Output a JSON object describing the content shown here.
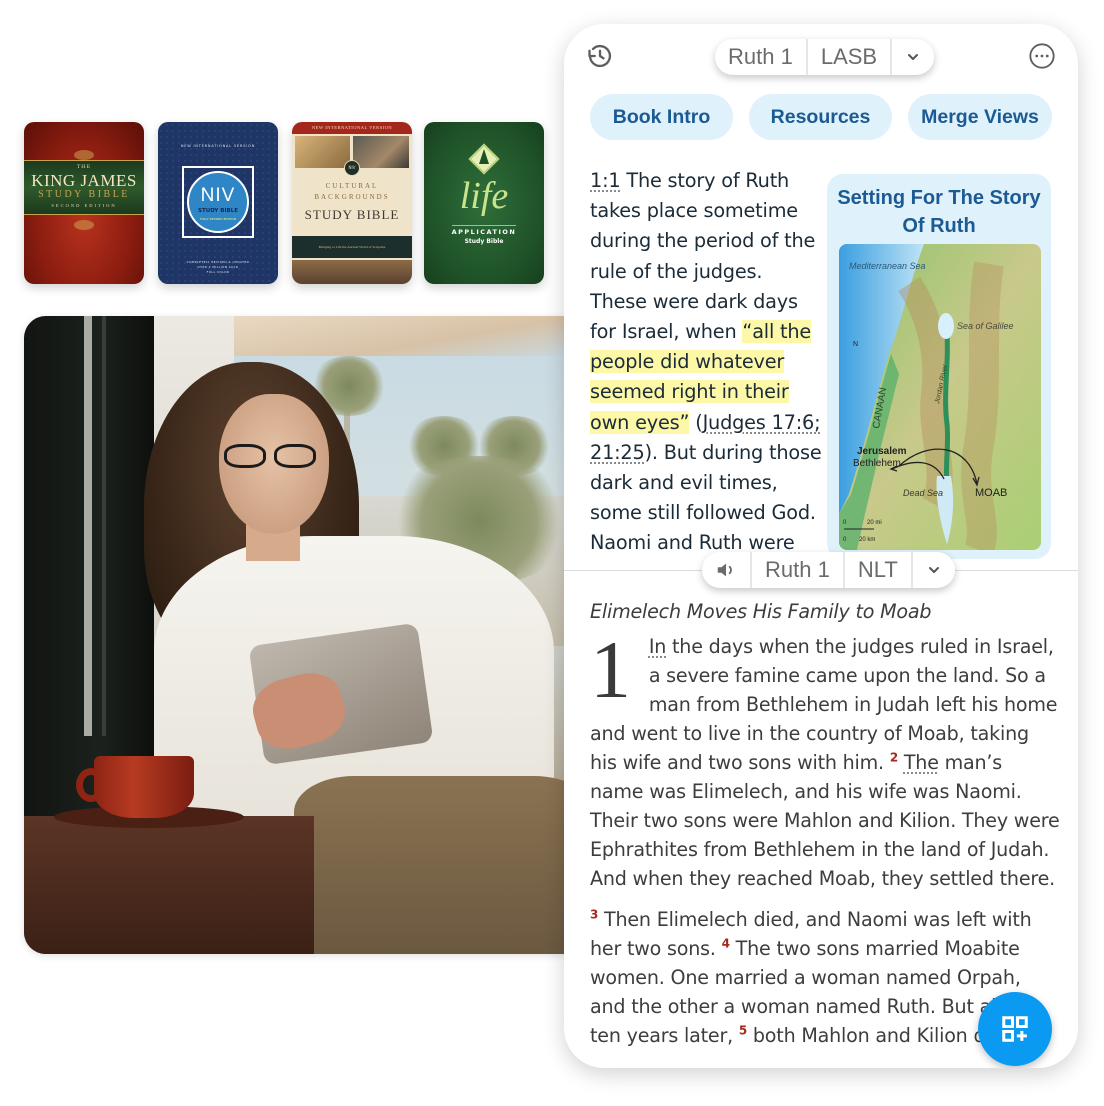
{
  "books": [
    {
      "id": "kjv",
      "line_small": "THE",
      "line1": "KING JAMES",
      "line2": "STUDY BIBLE",
      "line3": "SECOND EDITION"
    },
    {
      "id": "niv",
      "top": "NEW INTERNATIONAL VERSION",
      "title": "NIV",
      "subtitle": "STUDY BIBLE",
      "edition": "FULLY REVISED EDITION",
      "bottom": [
        "COMPLETELY REVISED & UPDATED",
        "OVER 2 MILLION SOLD",
        "FULL COLOR"
      ]
    },
    {
      "id": "cultural",
      "top": "NEW INTERNATIONAL VERSION",
      "badge": "NIV",
      "line1": "CULTURAL",
      "line2": "BACKGROUNDS",
      "line3": "STUDY BIBLE",
      "tagline": "Bringing to Life the Ancient World of Scripture"
    },
    {
      "id": "life",
      "title": "life",
      "line1": "APPLICATION",
      "line2": "Study Bible"
    }
  ],
  "photo": {
    "description": "woman-reading-tablet"
  },
  "reader": {
    "top_bar": {
      "history_icon": "history-icon",
      "more_icon": "more-horizontal-icon",
      "selector": {
        "book_chapter": "Ruth 1",
        "version": "LASB",
        "dropdown_icon": "chevron-down-icon"
      }
    },
    "tabs": [
      {
        "label": "Book Intro"
      },
      {
        "label": "Resources"
      },
      {
        "label": "Merge Views"
      }
    ],
    "commentary": {
      "ref": "1:1",
      "text_before": " The story of Ruth takes place sometime during the period of the rule of the judges. These were dark days for Israel, when ",
      "highlight": "“all the people did whatever seemed right in their own eyes”",
      "paren_open": " (",
      "cross_ref": "Judges 17:6; 21:25",
      "text_after": "). But during those dark and evil times, some still followed God. Naomi and Ruth were shining examples of strong character and staunch loyalty."
    },
    "map_card": {
      "title": "Setting For The Story Of Ruth",
      "labels": {
        "sea": "Mediterranean Sea",
        "galilee": "Sea of Galilee",
        "jordan": "Jordan River",
        "canaan": "CANAAN",
        "jerusalem": "Jerusalem",
        "bethlehem": "Bethlehem",
        "dead_sea": "Dead Sea",
        "moab": "MOAB",
        "north": "N",
        "scale_mi": "20 mi",
        "scale_km": "20 km",
        "zero": "0"
      }
    },
    "bottom_bar": {
      "audio_icon": "speaker-icon",
      "book_chapter": "Ruth 1",
      "version": "NLT",
      "dropdown_icon": "chevron-down-icon"
    },
    "scripture": {
      "heading": "Elimelech Moves His Family to Moab",
      "chapter": "1",
      "v1_first": "In",
      "v1_rest": " the days when the judges ruled in Israel, a severe famine came upon the land. So a man from Bethlehem in Judah left his home and went to live in the country of Moab, taking his wife and two sons with him.",
      "v2_num": "2",
      "v2_first": "The",
      "v2_rest": " man’s name was Elimelech, and his wife was Naomi. Their two sons were Mahlon and Kilion. They were Ephrathites from Bethlehem in the land of Judah. And when they reached Moab, they settled there.",
      "v3_num": "3",
      "v3": " Then Elimelech died, and Naomi was left with her two sons. ",
      "v4_num": "4",
      "v4": " The two sons married Moabite women. One married a woman named Orpah, and the other a woman named Ruth. But about ten years later, ",
      "v5_num": "5",
      "v5": " both Mahlon and Kilion died."
    },
    "fab_icon": "add-widget-icon"
  },
  "colors": {
    "accent": "#0b9af2",
    "tab_bg": "#dff1fb",
    "tab_text": "#1c5a94",
    "highlight": "#fcf8a7",
    "verse_number": "#a42a1f"
  }
}
